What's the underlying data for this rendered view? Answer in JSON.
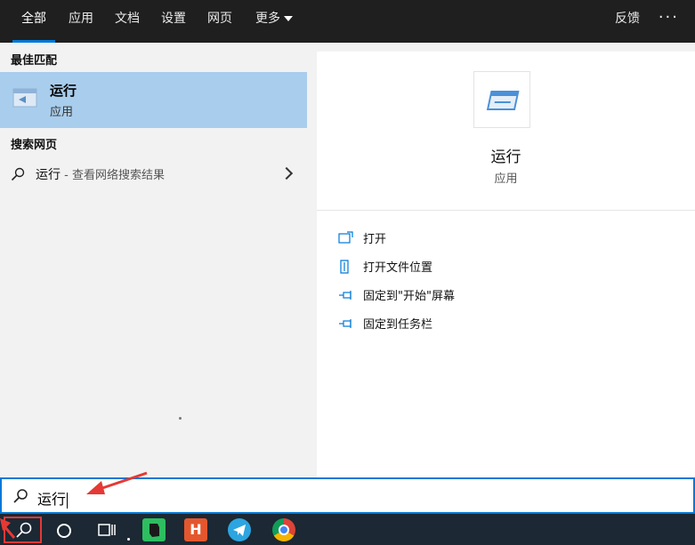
{
  "tabs": [
    {
      "label": "全部",
      "active": true
    },
    {
      "label": "应用"
    },
    {
      "label": "文档"
    },
    {
      "label": "设置"
    },
    {
      "label": "网页"
    },
    {
      "label": "更多"
    }
  ],
  "header": {
    "feedback": "反馈",
    "more_options": "···"
  },
  "left": {
    "best_match_title": "最佳匹配",
    "best_match": {
      "name": "运行",
      "type": "应用"
    },
    "web_title": "搜索网页",
    "web_result": {
      "query": "运行",
      "suffix": " - 查看网络搜索结果"
    }
  },
  "right": {
    "app_name": "运行",
    "app_type": "应用",
    "actions": [
      {
        "label": "打开",
        "icon": "open-icon"
      },
      {
        "label": "打开文件位置",
        "icon": "file-location-icon"
      },
      {
        "label": "固定到\"开始\"屏幕",
        "icon": "pin-icon"
      },
      {
        "label": "固定到任务栏",
        "icon": "pin-icon"
      }
    ]
  },
  "search": {
    "value": "运行"
  },
  "colors": {
    "accent": "#0078d7",
    "selected": "#a9cdec",
    "annotation": "#e53935"
  }
}
